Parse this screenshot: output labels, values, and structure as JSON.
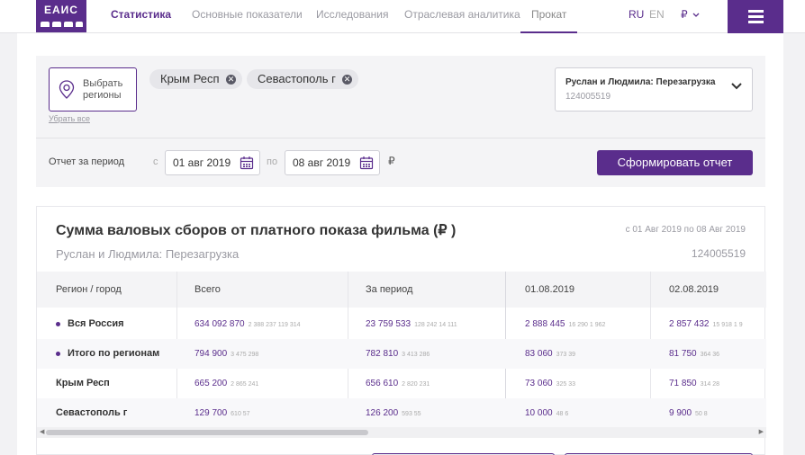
{
  "header": {
    "logo_text": "ЕАИС",
    "nav": [
      "Статистика",
      "Основные показатели",
      "Исследования",
      "Отраслевая аналитика",
      "Прокат"
    ],
    "lang_ru": "RU",
    "lang_en": "EN",
    "currency": "₽"
  },
  "filters": {
    "regions_button": "Выбрать регионы",
    "clear_all": "Убрать все",
    "chips": [
      "Крым Респ",
      "Севастополь г"
    ],
    "film_title": "Руслан и Людмила: Перезагрузка",
    "film_id": "124005519",
    "period_label": "Отчет за период",
    "from_label": "с",
    "to_label": "по",
    "date_from": "01 авг 2019",
    "date_to": "08 авг 2019",
    "currency": "₽",
    "submit": "Сформировать отчет"
  },
  "report": {
    "title": "Сумма валовых сборов от платного показа фильма (₽ )",
    "film": "Руслан и Людмила: Перезагрузка",
    "range": "с 01 Авг 2019 по 08 Авг 2019",
    "film_id": "124005519",
    "columns": [
      "Регион / город",
      "Всего",
      "За период",
      "01.08.2019",
      "02.08.2019"
    ],
    "rows": [
      {
        "name": "Вся Россия",
        "dot": true,
        "c1": "634 092 870",
        "c1m": "2 388 237   119 314",
        "c2": "23 759 533",
        "c2m": "128 242   14 111",
        "c3": "2 888 445",
        "c3m": "16 290   1 962",
        "c4": "2 857 432",
        "c4m": "15 918   1 9"
      },
      {
        "name": "Итого по регионам",
        "dot": true,
        "c1": "794 900",
        "c1m": "3 475   298",
        "c2": "782 810",
        "c2m": "3 413   286",
        "c3": "83 060",
        "c3m": "373   39",
        "c4": "81 750",
        "c4m": "364   36"
      },
      {
        "name": "Крым Респ",
        "dot": false,
        "c1": "665 200",
        "c1m": "2 865   241",
        "c2": "656 610",
        "c2m": "2 820   231",
        "c3": "73 060",
        "c3m": "325   33",
        "c4": "71 850",
        "c4m": "314   28"
      },
      {
        "name": "Севастополь г",
        "dot": false,
        "c1": "129 700",
        "c1m": "610   57",
        "c2": "126 200",
        "c2m": "593   55",
        "c3": "10 000",
        "c3m": "48   6",
        "c4": "9 900",
        "c4m": "50   8"
      }
    ]
  }
}
